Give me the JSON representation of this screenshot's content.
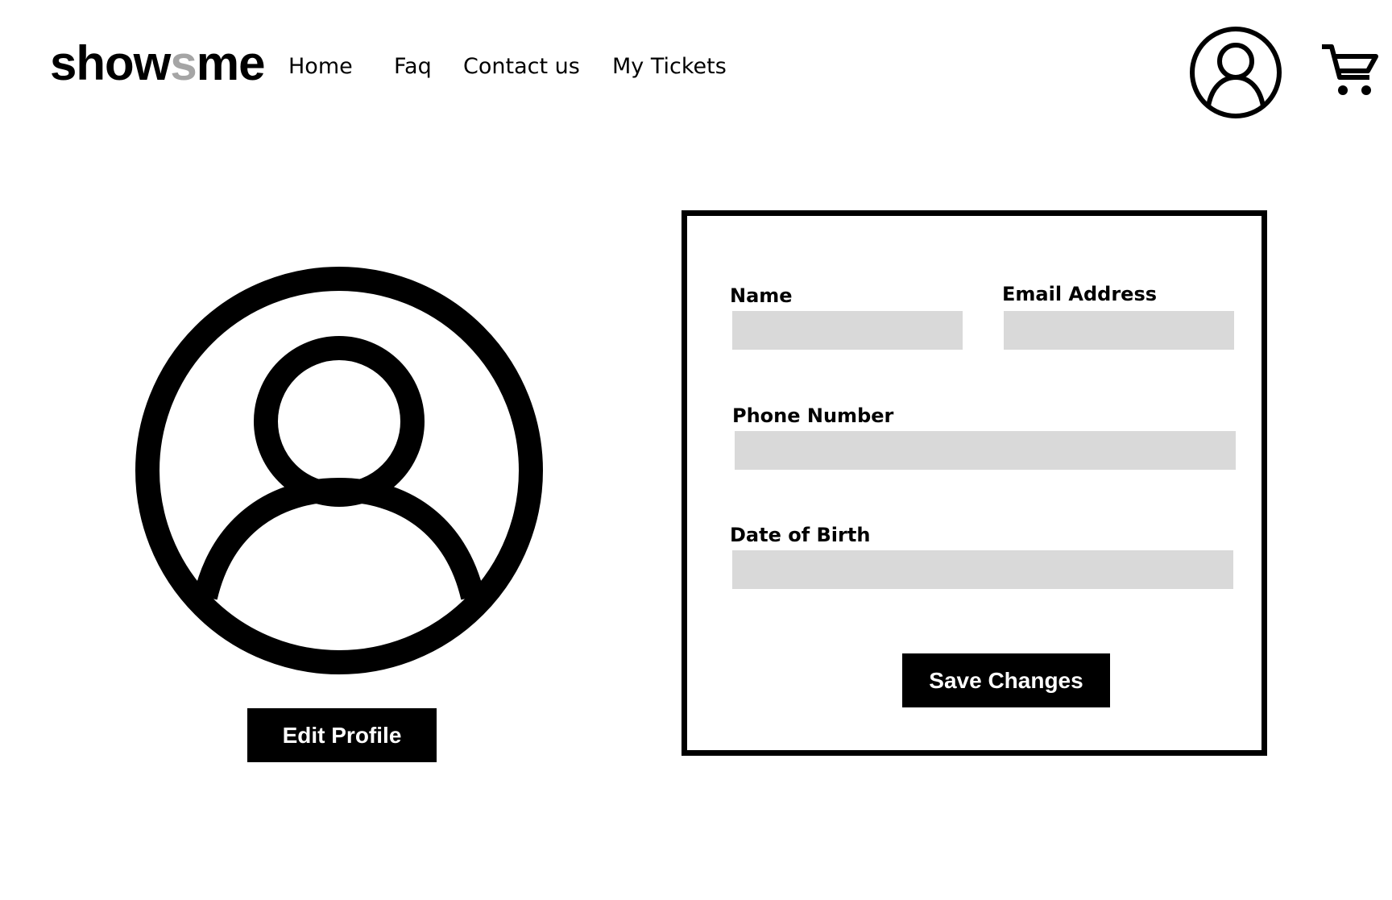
{
  "brand": {
    "prefix": "show",
    "accent": "s",
    "suffix": "me",
    "accent_color": "#a5a5a5"
  },
  "nav": {
    "home": "Home",
    "faq": "Faq",
    "contact": "Contact us",
    "tickets": "My Tickets"
  },
  "header_icons": {
    "account": "user-circle-icon",
    "cart": "shopping-cart-icon"
  },
  "profile": {
    "avatar": "user-avatar-icon",
    "edit_label": "Edit Profile"
  },
  "form": {
    "name_label": "Name",
    "name_value": "",
    "email_label": "Email Address",
    "email_value": "",
    "phone_label": "Phone Number",
    "phone_value": "",
    "dob_label": "Date of Birth",
    "dob_value": "",
    "save_label": "Save Changes"
  },
  "colors": {
    "text": "#000000",
    "background": "#ffffff",
    "input_fill": "#d9d9d9",
    "button": "#000000"
  }
}
